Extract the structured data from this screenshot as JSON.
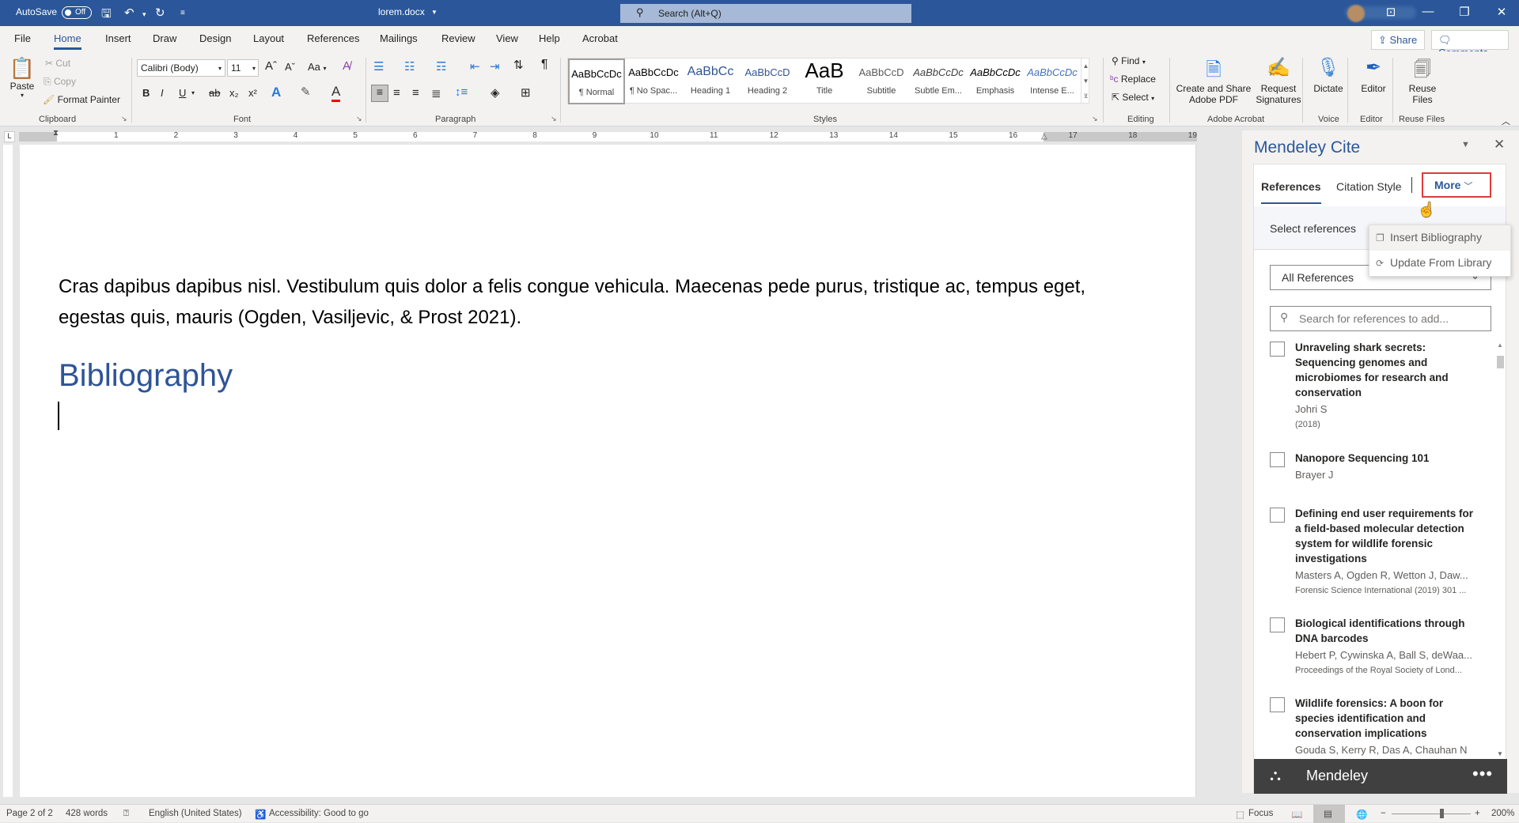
{
  "titlebar": {
    "autosave_label": "AutoSave",
    "autosave_state": "Off",
    "doc_title": "lorem.docx",
    "search_placeholder": "Search (Alt+Q)",
    "quick_access": [
      "save-icon",
      "undo-icon",
      "redo-icon",
      "customize-icon"
    ],
    "window_buttons": [
      "ribbon-display-icon",
      "minimize-icon",
      "restore-icon",
      "close-icon"
    ]
  },
  "tabs": {
    "items": [
      "File",
      "Home",
      "Insert",
      "Draw",
      "Design",
      "Layout",
      "References",
      "Mailings",
      "Review",
      "View",
      "Help",
      "Acrobat"
    ],
    "active": "Home",
    "share_label": "Share",
    "comments_label": "Comments"
  },
  "ribbon": {
    "clipboard": {
      "label": "Clipboard",
      "paste": "Paste",
      "cut": "Cut",
      "copy": "Copy",
      "format_painter": "Format Painter"
    },
    "font": {
      "label": "Font",
      "font_name": "Calibri (Body)",
      "font_size": "11",
      "change_case": "Aa",
      "buttons": [
        "B",
        "I",
        "U",
        "ab",
        "x₂",
        "x²"
      ]
    },
    "paragraph": {
      "label": "Paragraph"
    },
    "styles": {
      "label": "Styles",
      "items": [
        {
          "preview": "AaBbCcDc",
          "name": "¶ Normal",
          "color": "#000000"
        },
        {
          "preview": "AaBbCcDc",
          "name": "¶ No Spac...",
          "color": "#000000"
        },
        {
          "preview": "AaBbCc",
          "name": "Heading 1",
          "color": "#2f5496"
        },
        {
          "preview": "AaBbCcD",
          "name": "Heading 2",
          "color": "#2f5496"
        },
        {
          "preview": "AaB",
          "name": "Title",
          "color": "#000000"
        },
        {
          "preview": "AaBbCcD",
          "name": "Subtitle",
          "color": "#595959"
        },
        {
          "preview": "AaBbCcDc",
          "name": "Subtle Em...",
          "color": "#404040"
        },
        {
          "preview": "AaBbCcDc",
          "name": "Emphasis",
          "color": "#000000"
        },
        {
          "preview": "AaBbCcDc",
          "name": "Intense E...",
          "color": "#4472c4"
        }
      ]
    },
    "editing": {
      "label": "Editing",
      "find": "Find",
      "replace": "Replace",
      "select": "Select"
    },
    "acrobat": {
      "label": "Adobe Acrobat",
      "create_share": [
        "Create and Share",
        "Adobe PDF"
      ],
      "request_sig": [
        "Request",
        "Signatures"
      ]
    },
    "voice": {
      "label": "Voice",
      "dictate": "Dictate"
    },
    "editor": {
      "label": "Editor",
      "editor": "Editor"
    },
    "reuse": {
      "label": "Reuse Files",
      "reuse": [
        "Reuse",
        "Files"
      ]
    }
  },
  "ruler": {
    "numbers": [
      "1",
      "2",
      "3",
      "4",
      "5",
      "6",
      "7",
      "8",
      "9",
      "10",
      "11",
      "12",
      "13",
      "14",
      "15",
      "16",
      "17",
      "18",
      "19"
    ]
  },
  "document": {
    "paragraph": "Cras dapibus dapibus nisl. Vestibulum quis dolor a felis congue vehicula. Maecenas pede purus, tristique ac, tempus eget, egestas quis, mauris (Ogden, Vasiljevic, & Prost 2021).",
    "heading": "Bibliography"
  },
  "mendeley": {
    "title": "Mendeley Cite",
    "tabs": [
      "References",
      "Citation Style"
    ],
    "active_tab": "References",
    "more_label": "More",
    "info_text": "Select references",
    "dropdown": [
      {
        "label": "Insert Bibliography",
        "icon": "copy-icon"
      },
      {
        "label": "Update From Library",
        "icon": "refresh-icon"
      }
    ],
    "filter_value": "All References",
    "search_placeholder": "Search for references to add...",
    "references": [
      {
        "title": "Unraveling shark secrets: Sequencing genomes and microbiomes for research and conservation",
        "authors": "Johri S",
        "journal": "(2018)"
      },
      {
        "title": "Nanopore Sequencing 101",
        "authors": "Brayer J",
        "journal": ""
      },
      {
        "title": "Defining end user requirements for a field-based molecular detection system for wildlife forensic investigations",
        "authors": "Masters A, Ogden R, Wetton J, Daw...",
        "journal": "Forensic Science International (2019) 301 ..."
      },
      {
        "title": "Biological identifications through DNA barcodes",
        "authors": "Hebert P, Cywinska A, Ball S, deWaa...",
        "journal": "Proceedings of the Royal Society of Lond..."
      },
      {
        "title": "Wildlife forensics: A boon for species identification and conservation implications",
        "authors": "Gouda S, Kerry R, Das A, Chauhan N",
        "journal": ""
      }
    ],
    "footer_brand": "Mendeley",
    "footer_menu": "•••"
  },
  "status": {
    "page": "Page 2 of 2",
    "words": "428 words",
    "language": "English (United States)",
    "accessibility": "Accessibility: Good to go",
    "focus": "Focus",
    "zoom": "200%",
    "zoom_percent": 200
  },
  "colors": {
    "accent": "#2b579a",
    "heading": "#2f5496",
    "highlight_box": "#e03b3b",
    "mendeley_footer": "#404040"
  }
}
